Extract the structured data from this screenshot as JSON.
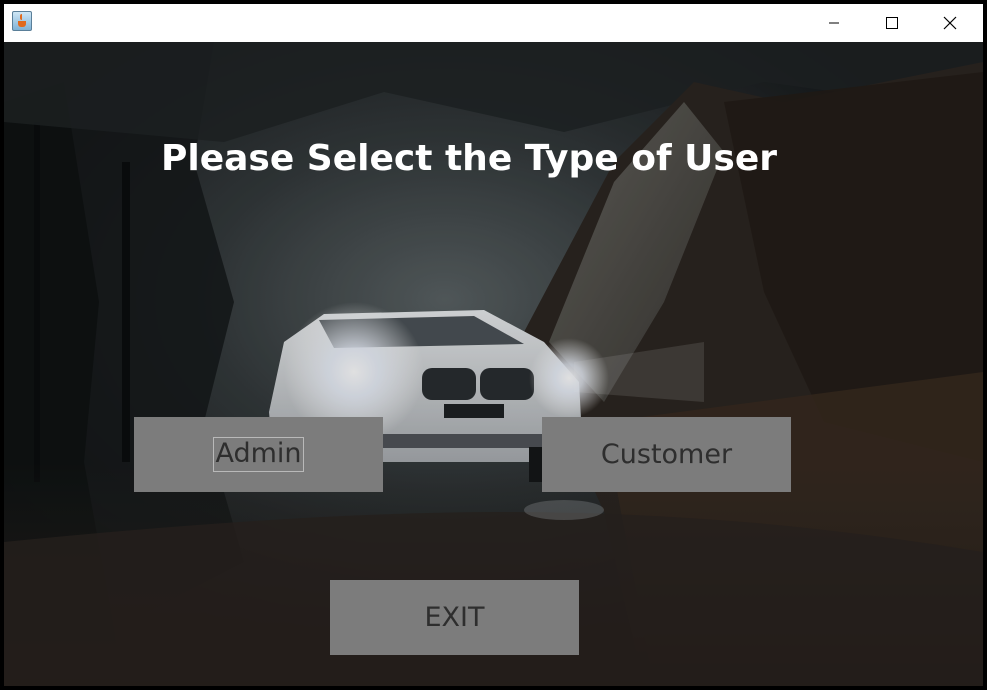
{
  "window": {
    "icon": "java-cup-icon",
    "controls": {
      "minimize": "minimize-icon",
      "maximize": "maximize-icon",
      "close": "close-icon"
    }
  },
  "main": {
    "heading": "Please Select the Type of User",
    "buttons": {
      "admin": "Admin",
      "customer": "Customer",
      "exit": "EXIT"
    }
  },
  "colors": {
    "button_bg": "#7c7c7c",
    "button_text": "#2e2e2e",
    "heading_text": "#ffffff",
    "titlebar_bg": "#ffffff"
  },
  "background": {
    "description_icon": "car-forest-photo"
  }
}
